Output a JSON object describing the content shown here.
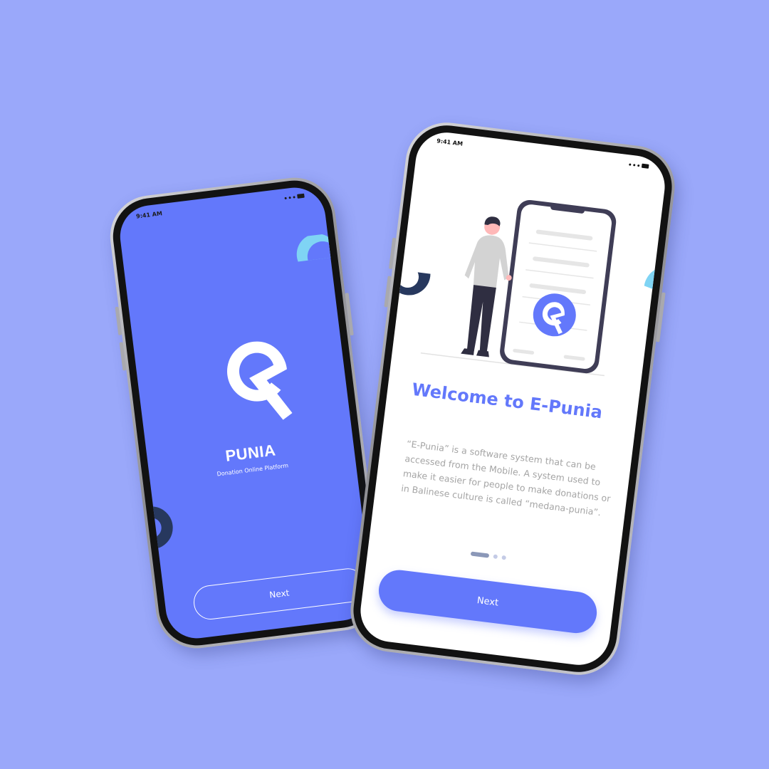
{
  "screens": {
    "splash": {
      "status_time": "9:41 AM",
      "brand_title": "PUNIA",
      "brand_subtitle": "Donation Online Platform",
      "next_label": "Next"
    },
    "onboarding": {
      "status_time": "9:41 AM",
      "welcome_title": "Welcome to E-Punia",
      "welcome_body": "“E-Punia” is a software system that can be accessed from the Mobile. A system used to make it easier for people to make donations or in Balinese culture is called “medana-punia”.",
      "pager": {
        "current": 1,
        "total": 3
      },
      "next_label": "Next"
    }
  },
  "icons": {
    "logo": "e-punia-pin-logo-icon",
    "status_signal": "signal-icon",
    "status_wifi": "wifi-icon",
    "status_battery": "battery-icon"
  },
  "colors": {
    "background": "#9AA8FA",
    "primary": "#6378FB",
    "accent_cyan": "#7FD4F4",
    "accent_navy": "#27385E",
    "body_text": "#A5A5A5"
  }
}
